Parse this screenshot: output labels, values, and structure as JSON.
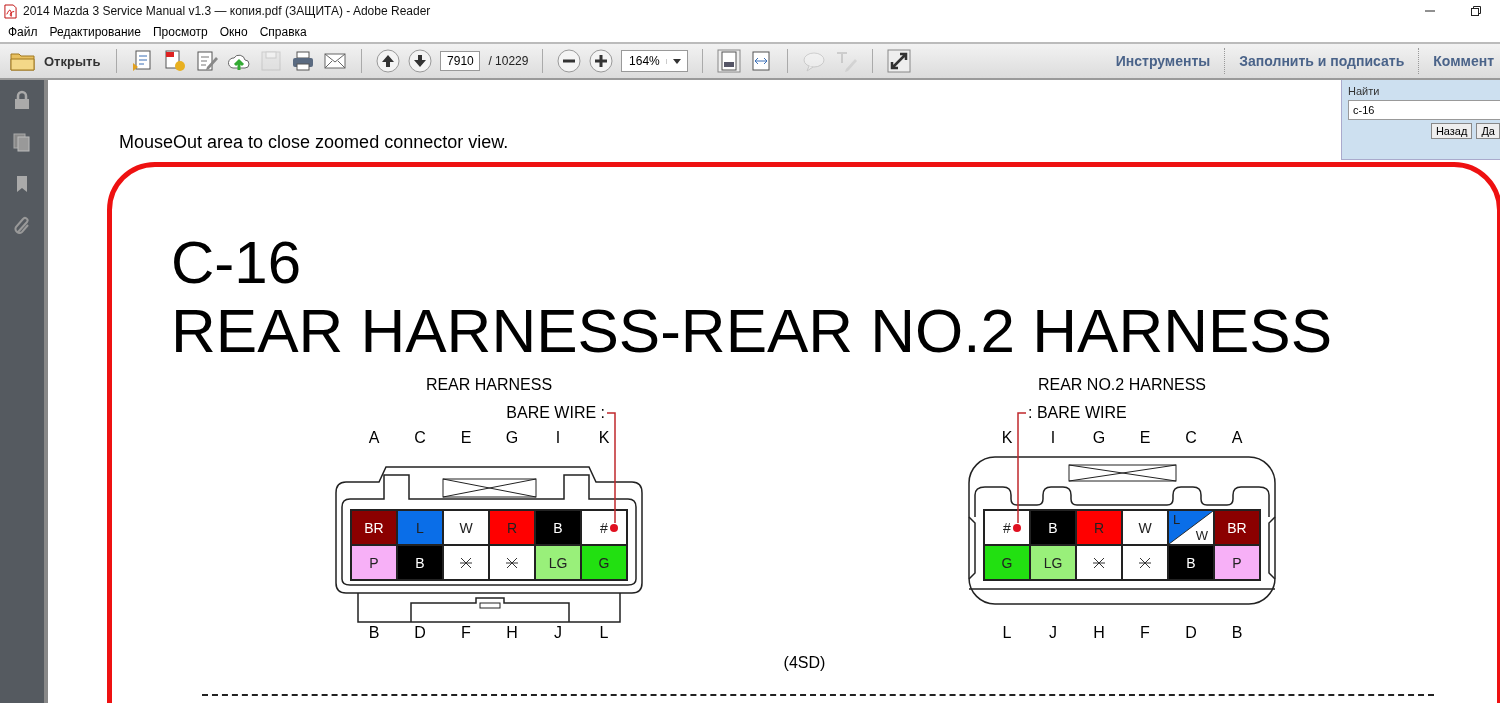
{
  "window": {
    "title": "2014 Mazda 3 Service Manual v1.3 — копия.pdf (ЗАЩИТА) - Adobe Reader"
  },
  "menu": [
    "Файл",
    "Редактирование",
    "Просмотр",
    "Окно",
    "Справка"
  ],
  "toolbar": {
    "open_label": "Открыть",
    "file_tools": [
      {
        "kind": "create",
        "disabled": false
      },
      {
        "kind": "combine",
        "disabled": false
      },
      {
        "kind": "edit",
        "disabled": false
      },
      {
        "kind": "upload",
        "disabled": false
      },
      {
        "kind": "save",
        "disabled": true
      },
      {
        "kind": "print",
        "disabled": false
      },
      {
        "kind": "mail",
        "disabled": false
      }
    ],
    "page_value": "7910",
    "page_total": "/ 10229",
    "zoom_value": "164%",
    "view_tools": [
      {
        "kind": "fitpage",
        "disabled": false
      },
      {
        "kind": "fitwidth",
        "disabled": false
      }
    ],
    "comment_tools": [
      {
        "kind": "comment",
        "disabled": true
      },
      {
        "kind": "markup",
        "disabled": true
      }
    ],
    "panels": [
      "Инструменты",
      "Заполнить и подписать",
      "Коммент"
    ]
  },
  "find": {
    "label": "Найти",
    "value": "c-16",
    "buttons": [
      "Назад",
      "Да"
    ]
  },
  "document": {
    "note": "MouseOut area to close zoomed connector view.",
    "code": "C-16",
    "title": "REAR HARNESS-REAR NO.2 HARNESS",
    "footer": "(4SD)",
    "connectors": [
      {
        "name": "REAR HARNESS",
        "kind": "latch-bottom",
        "bare_wire_label": "BARE WIRE :",
        "top_pins": [
          "A",
          "C",
          "E",
          "G",
          "I",
          "K"
        ],
        "bottom_pins": [
          "B",
          "D",
          "F",
          "H",
          "J",
          "L"
        ],
        "rows": [
          [
            {
              "kind": "wire",
              "text": "BR",
              "color": "#8b0000"
            },
            {
              "kind": "wire",
              "text": "L",
              "color": "#0a6ee8"
            },
            {
              "kind": "wire",
              "text": "W",
              "color": "#ffffff"
            },
            {
              "kind": "wire",
              "text": "R",
              "color": "#ff0000"
            },
            {
              "kind": "wire",
              "text": "B",
              "color": "#000000"
            },
            {
              "kind": "bare",
              "text": "#"
            }
          ],
          [
            {
              "kind": "wire",
              "text": "P",
              "color": "#f7b0f7"
            },
            {
              "kind": "wire",
              "text": "B",
              "color": "#000000"
            },
            {
              "kind": "unused"
            },
            {
              "kind": "unused"
            },
            {
              "kind": "wire",
              "text": "LG",
              "color": "#99f07a"
            },
            {
              "kind": "wire",
              "text": "G",
              "color": "#22e011"
            }
          ]
        ]
      },
      {
        "name": "REAR NO.2 HARNESS",
        "kind": "latch-top",
        "bare_wire_label": ": BARE WIRE",
        "top_pins": [
          "K",
          "I",
          "G",
          "E",
          "C",
          "A"
        ],
        "bottom_pins": [
          "L",
          "J",
          "H",
          "F",
          "D",
          "B"
        ],
        "rows": [
          [
            {
              "kind": "bare",
              "text": "#"
            },
            {
              "kind": "wire",
              "text": "B",
              "color": "#000000"
            },
            {
              "kind": "wire",
              "text": "R",
              "color": "#ff0000"
            },
            {
              "kind": "wire",
              "text": "W",
              "color": "#ffffff"
            },
            {
              "kind": "split",
              "text": "L",
              "text_2": "W",
              "color": "#0a6ee8"
            },
            {
              "kind": "wire",
              "text": "BR",
              "color": "#8b0000"
            }
          ],
          [
            {
              "kind": "wire",
              "text": "G",
              "color": "#22e011"
            },
            {
              "kind": "wire",
              "text": "LG",
              "color": "#99f07a"
            },
            {
              "kind": "unused"
            },
            {
              "kind": "unused"
            },
            {
              "kind": "wire",
              "text": "B",
              "color": "#000000"
            },
            {
              "kind": "wire",
              "text": "P",
              "color": "#f7b0f7"
            }
          ]
        ]
      }
    ]
  }
}
